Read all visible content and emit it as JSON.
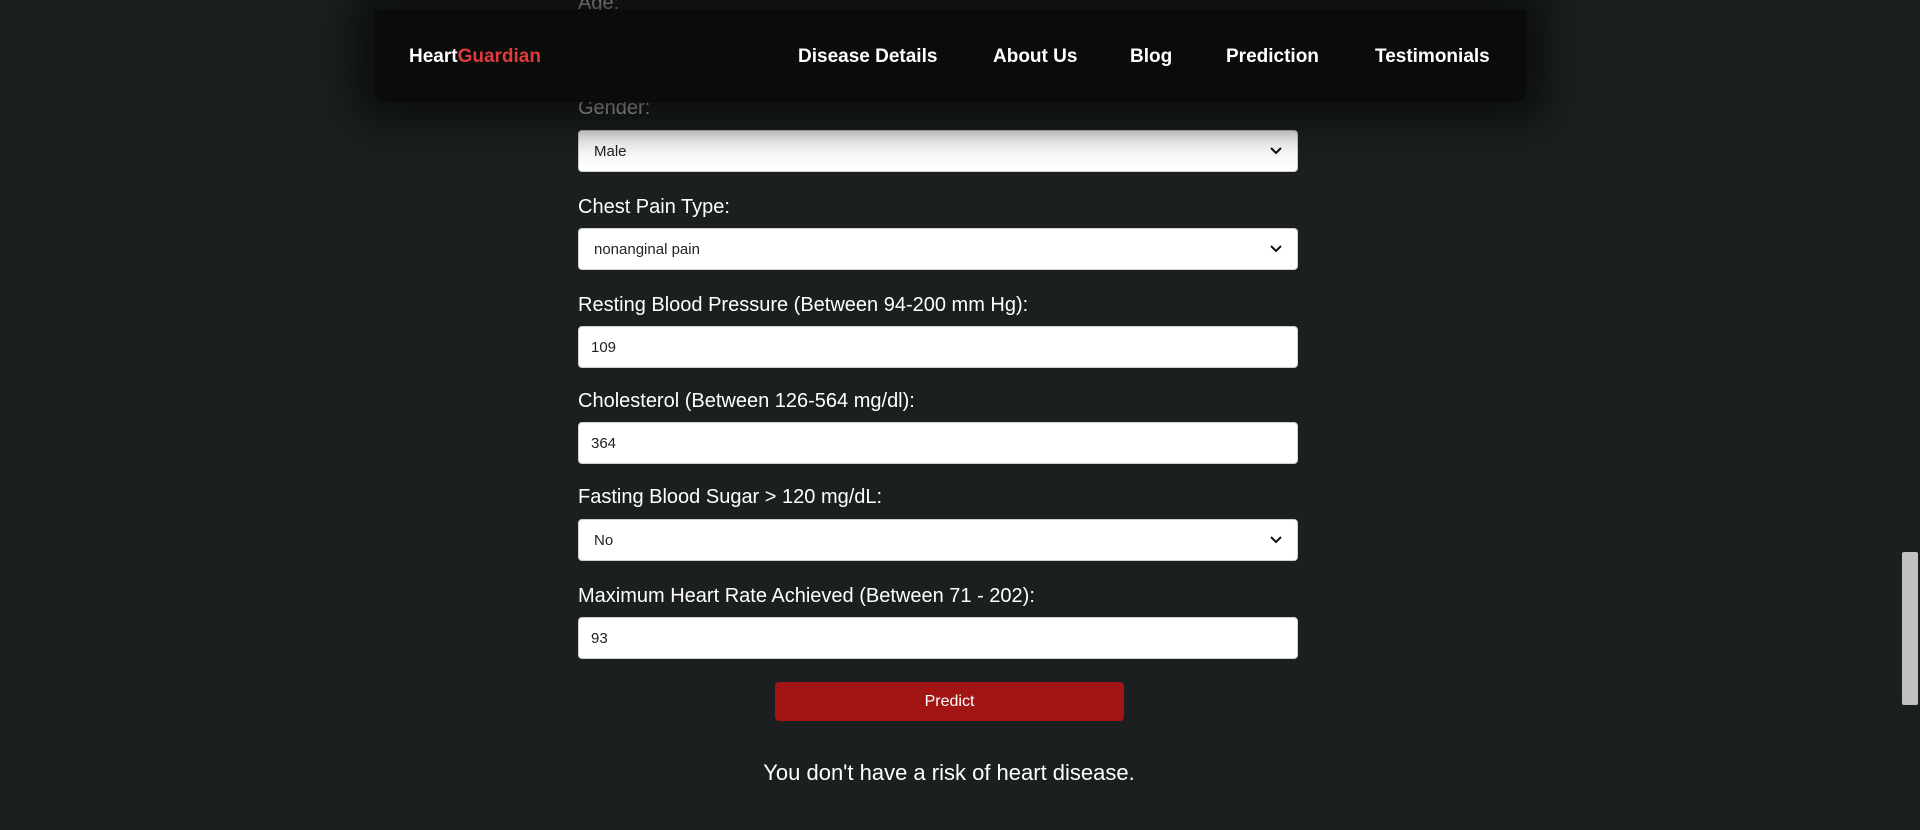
{
  "navbar": {
    "logo_part1": "Heart",
    "logo_part2": "Guardian",
    "items": [
      "Disease Details",
      "About Us",
      "Blog",
      "Prediction",
      "Testimonials"
    ]
  },
  "form": {
    "age_label": "Age:",
    "gender": {
      "label": "Gender:",
      "value": "Male"
    },
    "chest_pain": {
      "label": "Chest Pain Type:",
      "value": "nonanginal pain"
    },
    "resting_bp": {
      "label": "Resting Blood Pressure (Between 94-200 mm Hg):",
      "value": "109"
    },
    "cholesterol": {
      "label": "Cholesterol (Between 126-564 mg/dl):",
      "value": "364"
    },
    "fasting_sugar": {
      "label": "Fasting Blood Sugar > 120 mg/dL:",
      "value": "No"
    },
    "max_hr": {
      "label": "Maximum Heart Rate Achieved (Between 71 - 202):",
      "value": "93"
    },
    "predict_label": "Predict"
  },
  "result": "You don't have a risk of heart disease.",
  "colors": {
    "background": "#1b1f1f",
    "navbar": "#0a0c0c",
    "accent_red": "#e03a3a",
    "button_red": "#a31515"
  }
}
